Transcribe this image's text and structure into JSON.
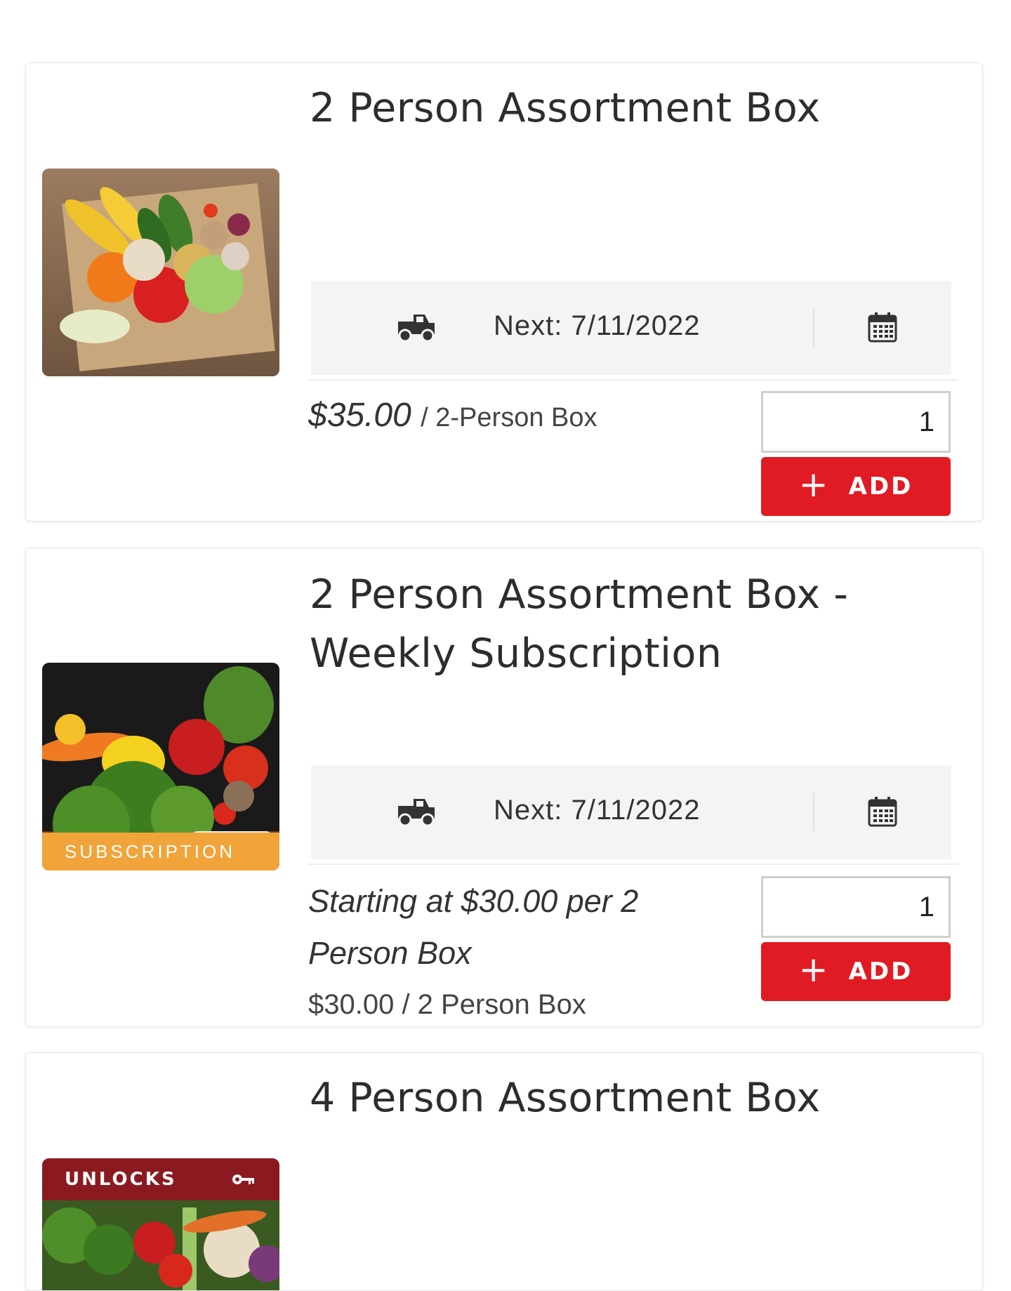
{
  "products": [
    {
      "title": "2 Person Assortment Box",
      "delivery": {
        "next_label": "Next: 7/11/2022"
      },
      "price": "$35.00",
      "unit": "/ 2-Person Box",
      "quantity": "1",
      "add_label": "ADD"
    },
    {
      "title": "2 Person Assortment Box - Weekly Subscription",
      "badge": "SUBSCRIPTION",
      "delivery": {
        "next_label": "Next: 7/11/2022"
      },
      "starting_text": "Starting at $30.00 per 2 Person Box",
      "price_detail": "$30.00 / 2 Person Box",
      "quantity": "1",
      "add_label": "ADD"
    },
    {
      "title": "4 Person Assortment Box",
      "badge": "UNLOCKS"
    }
  ],
  "icons": {
    "truck": "truck-icon",
    "calendar": "calendar-icon",
    "plus": "plus-icon",
    "key": "key-icon"
  },
  "colors": {
    "add_button": "#e01b24",
    "subscription_badge": "#f0a43a",
    "unlocks_badge": "#8b1a20"
  }
}
